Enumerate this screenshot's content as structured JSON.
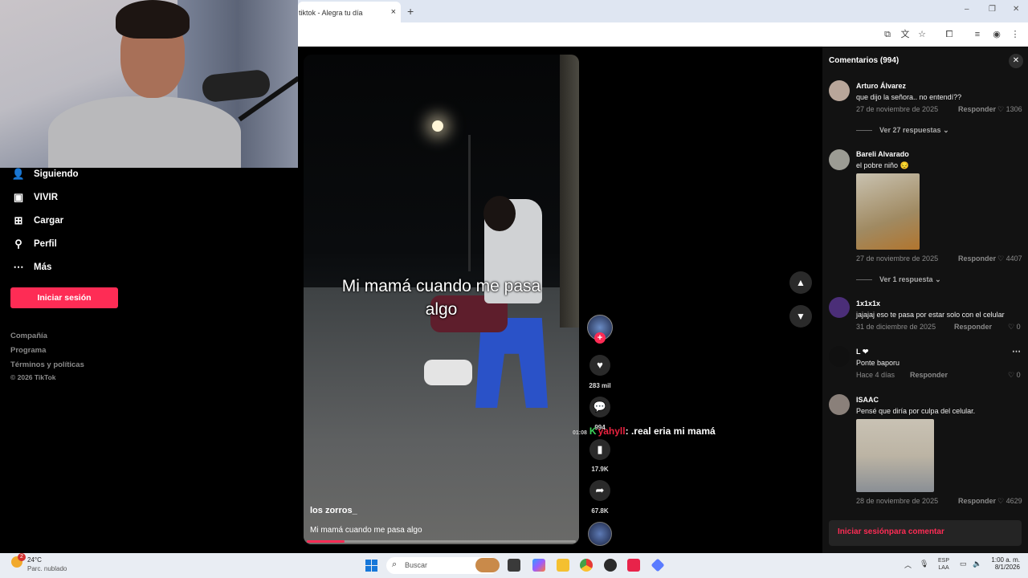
{
  "browser": {
    "tab_title": "tiktok - Alegra tu día",
    "tab_close": "×",
    "new_tab": "+",
    "window_controls": [
      "‒",
      "❐",
      "✕"
    ]
  },
  "sidebar": {
    "items": [
      {
        "label": "Siguiendo",
        "icon": "following-icon"
      },
      {
        "label": "VIVIR",
        "icon": "live-icon"
      },
      {
        "label": "Cargar",
        "icon": "upload-icon"
      },
      {
        "label": "Perfil",
        "icon": "profile-icon"
      },
      {
        "label": "Más",
        "icon": "more-icon"
      }
    ],
    "login_button": "Iniciar sesión",
    "footer_links": [
      "Compañía",
      "Programa",
      "Términos y políticas"
    ],
    "copyright": "© 2026 TikTok"
  },
  "video": {
    "caption_line1": "Mi mamá cuando me pasa",
    "caption_line2": "algo",
    "author": "los zorros_",
    "description": "Mi mamá cuando me pasa algo",
    "progress": 0.14
  },
  "actions": {
    "likes": "283 mil",
    "comments": "994",
    "saves": "17.9K",
    "shares": "67.8K"
  },
  "chat_overlay": {
    "time": "01:08",
    "badge": "K",
    "user": "yahyll",
    "message": ": .real eria mi mamá"
  },
  "comments": {
    "title": "Comentarios (994)",
    "login_prompt": "Iniciar sesiónpara comentar",
    "reply_label": "Responder",
    "items": [
      {
        "name": "Arturo Álvarez",
        "text": "que dijo la señora.. no entendí??",
        "date": "27 de noviembre de 2025",
        "likes": "1306",
        "replies": "Ver 27 respuestas"
      },
      {
        "name": "Bareli Alvarado",
        "text": "el pobre niño 😔",
        "date": "27 de noviembre de 2025",
        "likes": "4407",
        "replies": "Ver 1 respuesta"
      },
      {
        "name": "1x1x1x",
        "text": "jajajaj eso te pasa por estar solo con el celular",
        "date": "31 de diciembre de 2025",
        "likes": "0"
      },
      {
        "name": "L ❤",
        "text": "Ponte baporu",
        "date": "Hace 4 días",
        "likes": "0"
      },
      {
        "name": "ISAAC",
        "text": "Pensé que diría por culpa del celular.",
        "date": "28 de noviembre de 2025",
        "likes": "4629"
      }
    ]
  },
  "taskbar": {
    "temperature": "24°C",
    "weather": "Parc. nublado",
    "weather_badge": "2",
    "search_placeholder": "Buscar",
    "lang_top": "ESP",
    "lang_bottom": "LAA",
    "time": "1:00 a. m.",
    "date": "8/1/2026"
  }
}
